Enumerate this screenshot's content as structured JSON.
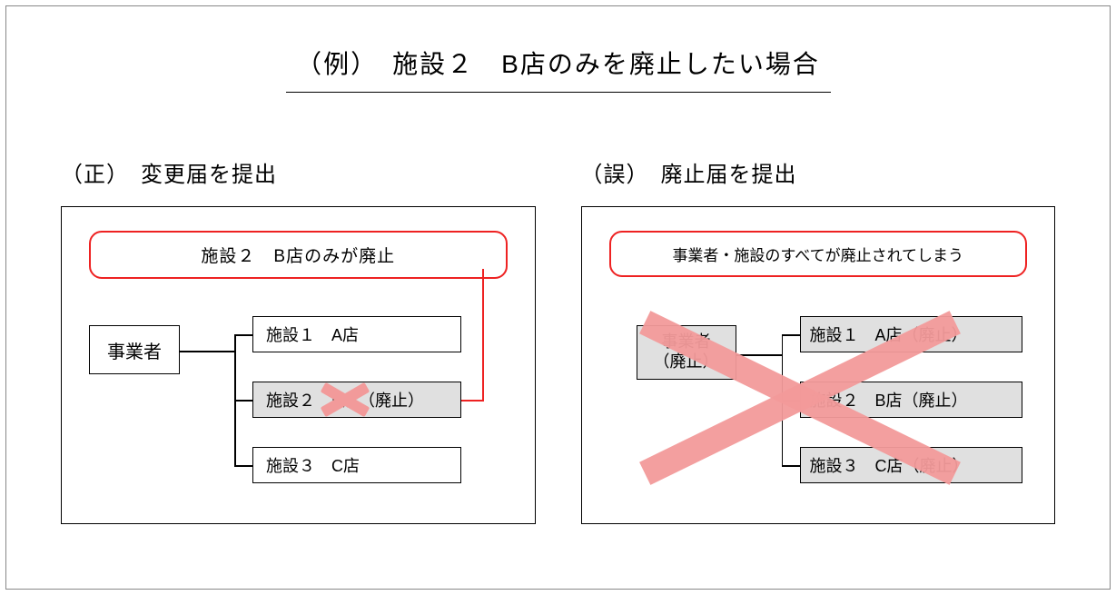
{
  "title": "（例）　施設２　B店のみを廃止したい場合",
  "left": {
    "heading": "（正）　変更届を提出",
    "note": "施設２　B店のみが廃止",
    "operator": "事業者",
    "facilities": [
      {
        "label": "施設１　A店"
      },
      {
        "label": "施設２　B店（廃止）"
      },
      {
        "label": "施設３　C店"
      }
    ]
  },
  "right": {
    "heading": "（誤）　廃止届を提出",
    "note": "事業者・施設のすべてが廃止されてしまう",
    "operator_line1": "事業者",
    "operator_line2": "（廃止）",
    "facilities": [
      {
        "label": "施設１　A店（廃止）"
      },
      {
        "label": "施設２　B店（廃止）"
      },
      {
        "label": "施設３　C店（廃止）"
      }
    ]
  }
}
